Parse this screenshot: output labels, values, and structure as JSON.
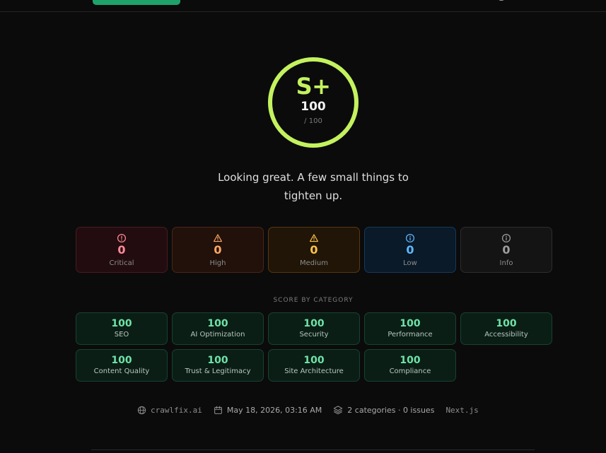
{
  "score": {
    "grade": "S+",
    "value": "100",
    "out_of": "/ 100",
    "ring_color": "#c4f25e"
  },
  "tagline": "Looking great. A few small things to tighten up.",
  "severity": [
    {
      "key": "critical",
      "label": "Critical",
      "count": "0",
      "icon": "alert-circle-icon",
      "color": "#ff8a95"
    },
    {
      "key": "high",
      "label": "High",
      "count": "0",
      "icon": "alert-triangle-icon",
      "color": "#ffa766"
    },
    {
      "key": "medium",
      "label": "Medium",
      "count": "0",
      "icon": "alert-triangle-icon",
      "color": "#ffc248"
    },
    {
      "key": "low",
      "label": "Low",
      "count": "0",
      "icon": "info-circle-icon",
      "color": "#5fb7ff"
    },
    {
      "key": "info",
      "label": "Info",
      "count": "0",
      "icon": "info-circle-icon",
      "color": "#9e9e9e"
    }
  ],
  "categories_title": "SCORE BY CATEGORY",
  "categories": [
    {
      "name": "SEO",
      "score": "100"
    },
    {
      "name": "AI Optimization",
      "score": "100"
    },
    {
      "name": "Security",
      "score": "100"
    },
    {
      "name": "Performance",
      "score": "100"
    },
    {
      "name": "Accessibility",
      "score": "100"
    },
    {
      "name": "Content Quality",
      "score": "100"
    },
    {
      "name": "Trust & Legitimacy",
      "score": "100"
    },
    {
      "name": "Site Architecture",
      "score": "100"
    },
    {
      "name": "Compliance",
      "score": "100"
    }
  ],
  "meta": {
    "domain": "crawlfix.ai",
    "date": "May 18, 2026, 03:16 AM",
    "summary": "2 categories · 0 issues",
    "framework": "Next.js"
  },
  "colors": {
    "accent_green": "#6fe3a6",
    "background": "#0b0b0c"
  }
}
